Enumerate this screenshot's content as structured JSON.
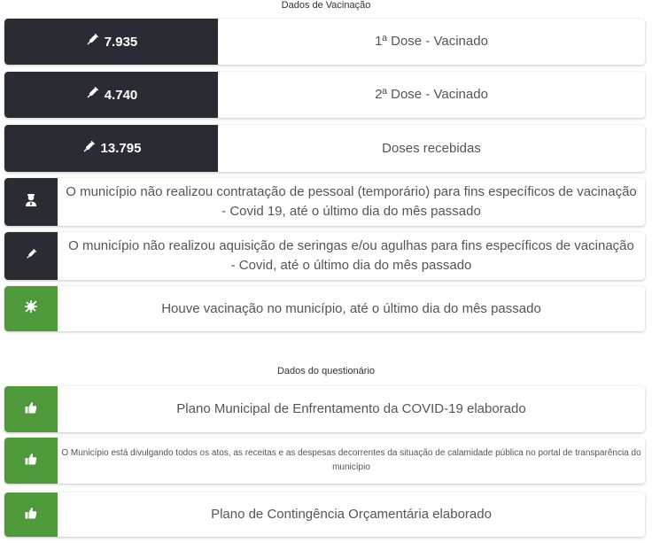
{
  "vacinacao": {
    "title": "Dados de Vacinação",
    "stats": [
      {
        "value": "7.935",
        "label": "1ª Dose - Vacinado"
      },
      {
        "value": "4.740",
        "label": "2ª Dose - Vacinado"
      },
      {
        "value": "13.795",
        "label": "Doses recebidas"
      }
    ],
    "info": [
      {
        "icon": "user-nurse-icon",
        "text": "O município não realizou contratação de pessoal (temporário) para fins específicos de vacinação - Covid 19, até o último dia do mês passado"
      },
      {
        "icon": "syringe-icon",
        "text": "O município não realizou aquisição de seringas e/ou agulhas para fins específicos de vacinação - Covid, até o último dia do mês passado"
      },
      {
        "icon": "virus-slash-icon",
        "text": "Houve vacinação no município, até o último dia do mês passado"
      }
    ]
  },
  "questionario": {
    "title": "Dados do questionário",
    "items": [
      {
        "icon": "thumbs-up-icon",
        "text": "Plano Municipal de Enfrentamento da COVID-19 elaborado"
      },
      {
        "icon": "thumbs-up-icon",
        "text": "O Município está divulgando todos os atos, as receitas e as despesas decorrentes da situação de calamidade pública no portal de transparência do município"
      },
      {
        "icon": "thumbs-up-icon",
        "text": "Plano de Contingência Orçamentária elaborado"
      }
    ]
  },
  "colors": {
    "dark": "#2b2b33",
    "green": "#4e9a3a"
  }
}
